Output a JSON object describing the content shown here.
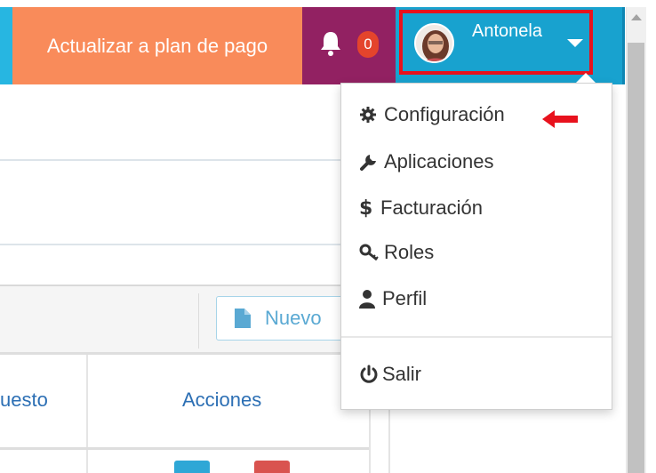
{
  "navbar": {
    "upgrade_label": "Actualizar a plan de pago",
    "notifications_count": "0",
    "user_name": "Antonela"
  },
  "toolbar": {
    "new_label": "Nuevo"
  },
  "table": {
    "headers": [
      "uesto",
      "Acciones"
    ]
  },
  "user_menu": {
    "items": [
      {
        "label": "Configuración",
        "icon": "gear-icon"
      },
      {
        "label": "Aplicaciones",
        "icon": "wrench-icon"
      },
      {
        "label": "Facturación",
        "icon": "dollar-icon"
      },
      {
        "label": "Roles",
        "icon": "key-icon"
      },
      {
        "label": "Perfil",
        "icon": "user-icon"
      },
      {
        "label": "Salir",
        "icon": "power-icon"
      }
    ]
  },
  "colors": {
    "upgrade_bg": "#f98b5a",
    "bell_bg": "#922162",
    "user_bg": "#18a2cf",
    "highlight": "#e8121d",
    "badge": "#e4442c",
    "link": "#2c6fb4"
  }
}
